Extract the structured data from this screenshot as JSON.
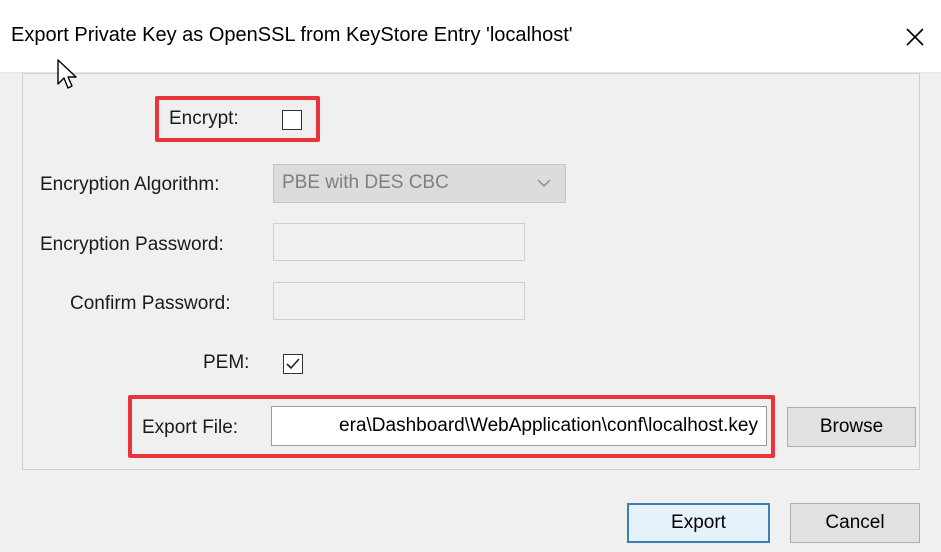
{
  "window": {
    "title": "Export Private Key as OpenSSL from KeyStore Entry 'localhost'"
  },
  "form": {
    "encrypt_label": "Encrypt:",
    "encrypt_checked": false,
    "algorithm_label": "Encryption Algorithm:",
    "algorithm_value": "PBE with DES CBC",
    "password_label": "Encryption Password:",
    "password_value": "",
    "confirm_label": "Confirm Password:",
    "confirm_value": "",
    "pem_label": "PEM:",
    "pem_checked": true,
    "export_file_label": "Export File:",
    "export_file_value": "era\\Dashboard\\WebApplication\\conf\\localhost.key",
    "browse_label": "Browse"
  },
  "footer": {
    "export_label": "Export",
    "cancel_label": "Cancel"
  },
  "colors": {
    "highlight": "#e8353b",
    "default_button_border": "#3c7fb1"
  },
  "icons": {
    "close": "close-icon",
    "checkmark": "checkmark-icon",
    "dropdown": "chevron-down-icon",
    "cursor": "mouse-pointer-icon"
  }
}
